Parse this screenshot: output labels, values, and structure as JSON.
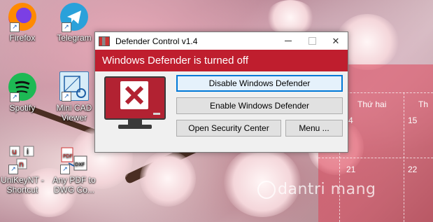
{
  "desktop": {
    "icons": [
      {
        "label": "Firefox"
      },
      {
        "label": "Telegram"
      },
      {
        "label": "Spotify"
      },
      {
        "label": "Mini CAD Viewer"
      },
      {
        "label": "UniKeyNT - Shortcut"
      },
      {
        "label": "Any PDF to DWG Co..."
      }
    ],
    "calendar": {
      "day_headers": [
        "Thứ hai"
      ],
      "partial_header": "Th",
      "dates": [
        "4",
        "15",
        "21",
        "22"
      ]
    },
    "watermark": "dantri mang"
  },
  "window": {
    "title": "Defender Control v1.4",
    "status_text": "Windows Defender is turned off",
    "status_color": "#bf1e2e",
    "buttons": {
      "disable": "Disable Windows Defender",
      "enable": "Enable Windows Defender",
      "security_center": "Open Security Center",
      "menu": "Menu ..."
    },
    "controls": {
      "close": "✕"
    }
  }
}
